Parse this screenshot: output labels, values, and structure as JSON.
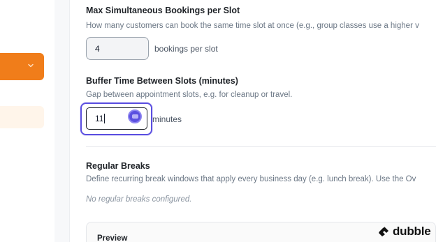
{
  "sidebar": {
    "select_icon": "chevron-down-icon",
    "accent_color": "#f07d1a",
    "highlight_color": "#fff5ea"
  },
  "max_bookings": {
    "label": "Max Simultaneous Bookings per Slot",
    "help": "How many customers can book the same time slot at once (e.g., group classes use a higher v",
    "value": "4",
    "unit": "bookings per slot"
  },
  "buffer_time": {
    "label": "Buffer Time Between Slots (minutes)",
    "help": "Gap between appointment slots, e.g. for cleanup or travel.",
    "value": "11",
    "unit": "minutes",
    "focus_color": "#5b4fe0"
  },
  "regular_breaks": {
    "label": "Regular Breaks",
    "help": "Define recurring break windows that apply every business day (e.g. lunch break). Use the Ov",
    "empty_note": "No regular breaks configured."
  },
  "preview": {
    "title": "Preview"
  },
  "watermark": {
    "text": "dubble",
    "icon": "dubble-logo-icon"
  }
}
